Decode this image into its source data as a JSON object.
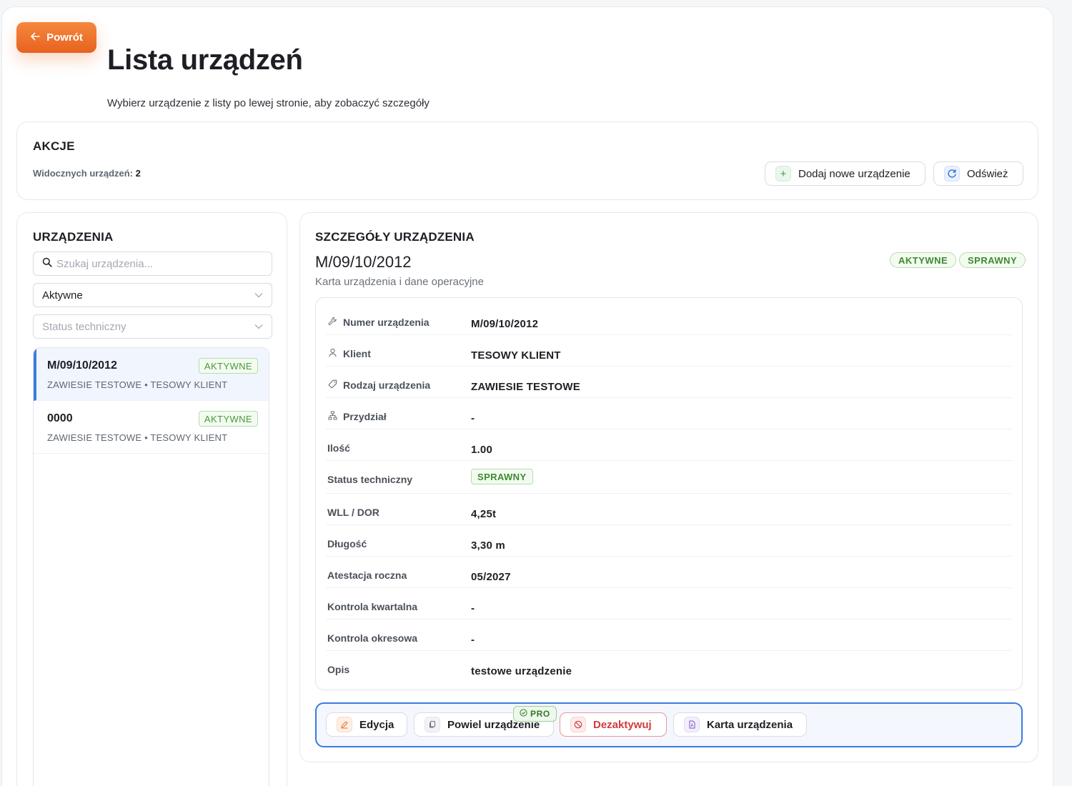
{
  "header": {
    "back_label": "Powrót",
    "title": "Lista urządzeń",
    "subtitle": "Wybierz urządzenie z listy po lewej stronie, aby zobaczyć szczegóły"
  },
  "actions": {
    "heading": "AKCJE",
    "visible_label": "Widocznych urządzeń:",
    "visible_count": "2",
    "add_label": "Dodaj nowe urządzenie",
    "refresh_label": "Odśwież"
  },
  "devices": {
    "heading": "URZĄDZENIA",
    "search_placeholder": "Szukaj urządzenia...",
    "filter_active": "Aktywne",
    "filter_status_placeholder": "Status techniczny",
    "items": [
      {
        "title": "M/09/10/2012",
        "badge": "AKTYWNE",
        "subtitle": "ZAWIESIE TESTOWE • TESOWY KLIENT",
        "selected": true
      },
      {
        "title": "0000",
        "badge": "AKTYWNE",
        "subtitle": "ZAWIESIE TESTOWE • TESOWY KLIENT",
        "selected": false
      }
    ]
  },
  "details": {
    "heading": "SZCZEGÓŁY URZĄDZENIA",
    "device_id": "M/09/10/2012",
    "device_subtitle": "Karta urządzenia i dane operacyjne",
    "status_pills": [
      "AKTYWNE",
      "SPRAWNY"
    ],
    "rows": [
      {
        "label": "Numer urządzenia",
        "value": "M/09/10/2012",
        "icon": "wrench-icon"
      },
      {
        "label": "Klient",
        "value": "TESOWY KLIENT",
        "icon": "user-icon"
      },
      {
        "label": "Rodzaj urządzenia",
        "value": "ZAWIESIE TESTOWE",
        "icon": "tag-icon"
      },
      {
        "label": "Przydział",
        "value": "-",
        "icon": "hierarchy-icon"
      },
      {
        "label": "Ilość",
        "value": "1.00"
      },
      {
        "label": "Status techniczny",
        "value": "SPRAWNY",
        "badge": true
      },
      {
        "label": "WLL / DOR",
        "value": "4,25t"
      },
      {
        "label": "Długość",
        "value": "3,30 m"
      },
      {
        "label": "Atestacja roczna",
        "value": "05/2027"
      },
      {
        "label": "Kontrola kwartalna",
        "value": "-"
      },
      {
        "label": "Kontrola okresowa",
        "value": "-"
      },
      {
        "label": "Opis",
        "value": "testowe urządzenie"
      }
    ]
  },
  "action_bar": {
    "edit_label": "Edycja",
    "duplicate_label": "Powiel urządzenie",
    "pro_label": "PRO",
    "deactivate_label": "Dezaktywuj",
    "card_label": "Karta urządzenia"
  },
  "colors": {
    "accent_orange": "#e8621e",
    "accent_blue": "#3b7be0",
    "success_green": "#3d8a2f",
    "danger_red": "#d23c3c"
  }
}
